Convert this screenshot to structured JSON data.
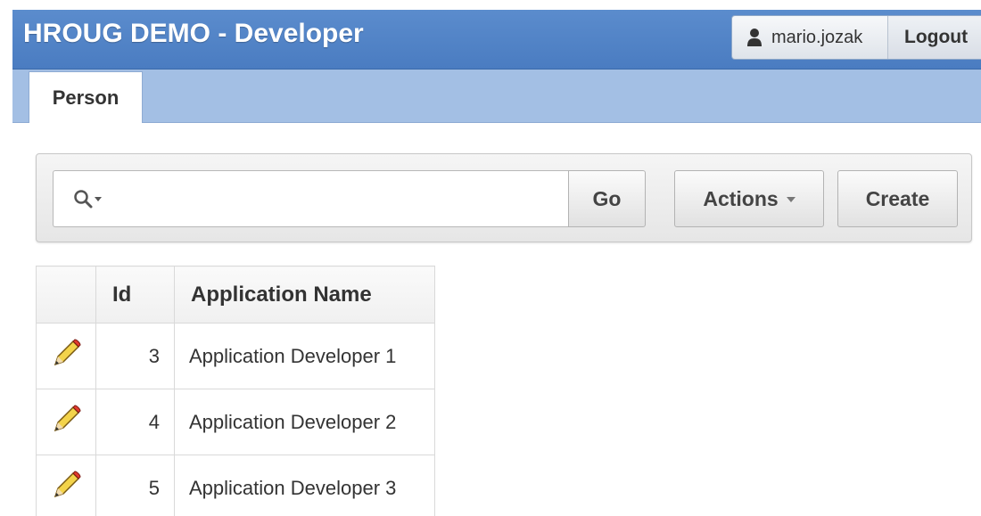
{
  "header": {
    "title": "HROUG DEMO - Developer",
    "user": "mario.jozak",
    "logout_label": "Logout",
    "icon_user": "user-icon"
  },
  "tabs": [
    {
      "label": "Person",
      "active": true
    }
  ],
  "toolbar": {
    "search_value": "",
    "search_icon": "search-icon",
    "go_label": "Go",
    "actions_label": "Actions",
    "create_label": "Create"
  },
  "report": {
    "columns": [
      "",
      "Id",
      "Application Name"
    ],
    "rows": [
      {
        "id": "3",
        "name": "Application Developer 1"
      },
      {
        "id": "4",
        "name": "Application Developer 2"
      },
      {
        "id": "5",
        "name": "Application Developer 3"
      }
    ],
    "edit_icon": "pencil-icon"
  },
  "colors": {
    "header": "#4a7cc1",
    "tabbar": "#a3bfe4"
  }
}
